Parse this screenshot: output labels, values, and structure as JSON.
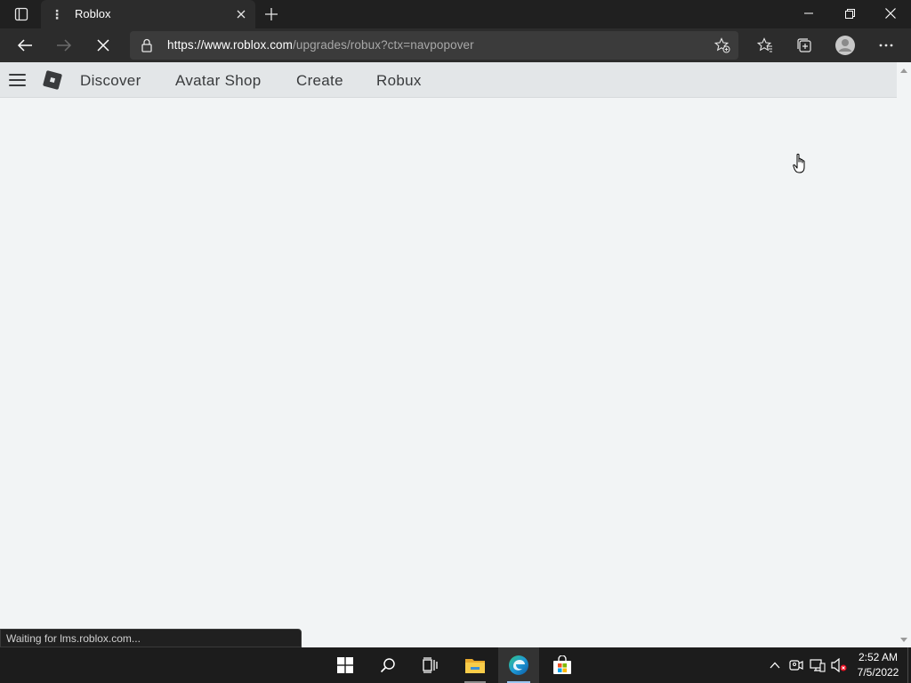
{
  "browser": {
    "tab": {
      "title": "Roblox",
      "favicon": "roblox-loading-icon"
    },
    "address": {
      "host": "https://www.roblox.com",
      "path": "/upgrades/robux?ctx=navpopover"
    },
    "status_text": "Waiting for lms.roblox.com...",
    "accent_color": "#202020"
  },
  "roblox": {
    "nav": {
      "discover": "Discover",
      "avatar_shop": "Avatar Shop",
      "create": "Create",
      "robux": "Robux"
    },
    "header_color": "#e3e6e8",
    "page_color": "#f2f4f5"
  },
  "taskbar": {
    "time": "2:52 AM",
    "date": "7/5/2022",
    "pinned": [
      "start-icon",
      "search-icon",
      "task-view-icon",
      "file-explorer-icon",
      "edge-icon",
      "store-icon"
    ]
  }
}
